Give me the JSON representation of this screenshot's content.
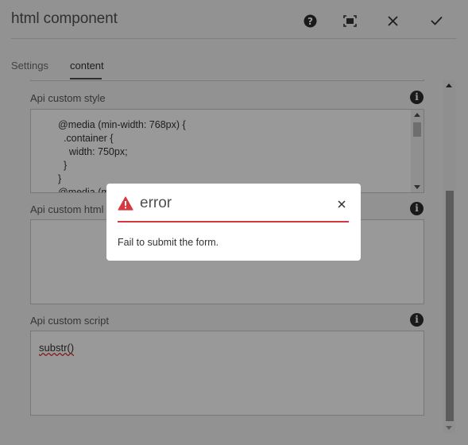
{
  "header": {
    "title": "html component",
    "help_icon": "help-icon",
    "fullscreen_icon": "fullscreen-icon",
    "close_icon": "close-icon",
    "done_icon": "checkmark-icon"
  },
  "tabs": [
    {
      "label": "Settings",
      "selected": false
    },
    {
      "label": "content",
      "selected": true
    }
  ],
  "fields": {
    "style": {
      "label": "Api custom style",
      "lines": [
        "@media (min-width: 768px) {",
        "  .container {",
        "    width: 750px;",
        "  }",
        "}",
        "@media (m"
      ]
    },
    "html": {
      "label": "Api custom html",
      "value": ""
    },
    "script": {
      "label": "Api custom script",
      "value": "substr()"
    }
  },
  "modal": {
    "title": "error",
    "message": "Fail to submit the form.",
    "alert_icon": "alert-icon",
    "close_icon": "close-icon",
    "accent_color": "#d7373f"
  },
  "colors": {
    "background": "#f4f4f4",
    "overlay": "rgba(0,0,0,0.40)",
    "error": "#d7373f"
  }
}
